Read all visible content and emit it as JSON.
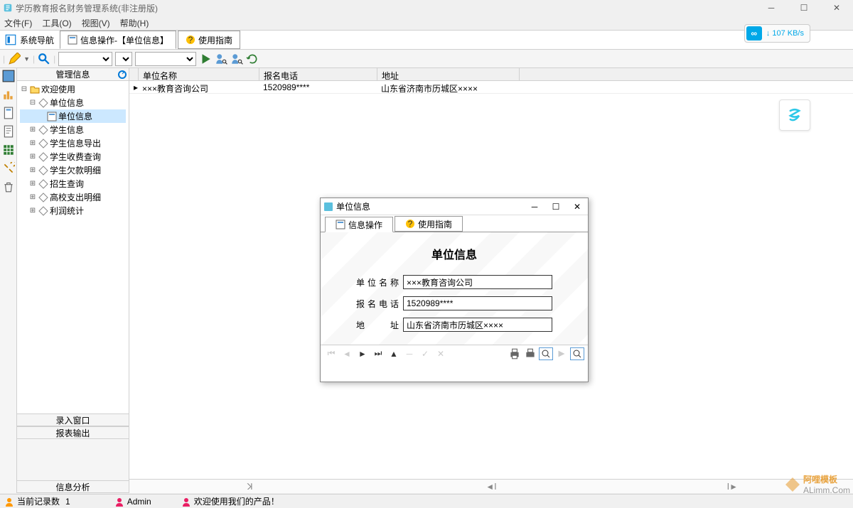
{
  "app": {
    "title": "学历教育报名财务管理系统(非注册版)"
  },
  "menu": {
    "file": "文件(F)",
    "tools": "工具(O)",
    "view": "视图(V)",
    "help": "帮助(H)"
  },
  "toolbar": {
    "nav": "系统导航",
    "tab1": "信息操作-【单位信息】",
    "tab2": "使用指南"
  },
  "speed": {
    "value": "↓ 107 KB/s",
    "icon_glyph": "∞"
  },
  "sidebar": {
    "header": "管理信息",
    "sections": {
      "entry": "录入窗口",
      "report": "报表输出",
      "analysis": "信息分析"
    }
  },
  "tree": {
    "root": "欢迎使用",
    "items": [
      "单位信息",
      "学生信息",
      "学生信息导出",
      "学生收费查询",
      "学生欠款明细",
      "招生查询",
      "高校支出明细",
      "利润统计"
    ],
    "sub_item": "单位信息"
  },
  "grid": {
    "headers": {
      "name": "单位名称",
      "phone": "报名电话",
      "addr": "地址"
    },
    "rows": [
      {
        "name": "×××教育咨询公司",
        "phone": "1520989****",
        "addr": "山东省济南市历城区××××"
      }
    ]
  },
  "dialog": {
    "title": "单位信息",
    "tab1": "信息操作",
    "tab2": "使用指南",
    "heading": "单位信息",
    "fields": {
      "name_label": "单位名称",
      "name_value": "×××教育咨询公司",
      "phone_label": "报名电话",
      "phone_value": "1520989****",
      "addr_label": "地　　址",
      "addr_value": "山东省济南市历城区××××"
    }
  },
  "status": {
    "records": "当前记录数",
    "count": "1",
    "user": "Admin",
    "welcome": "欢迎使用我们的产品！"
  },
  "watermark": {
    "brand": "阿哩模板",
    "url": "ALimm.Com"
  }
}
